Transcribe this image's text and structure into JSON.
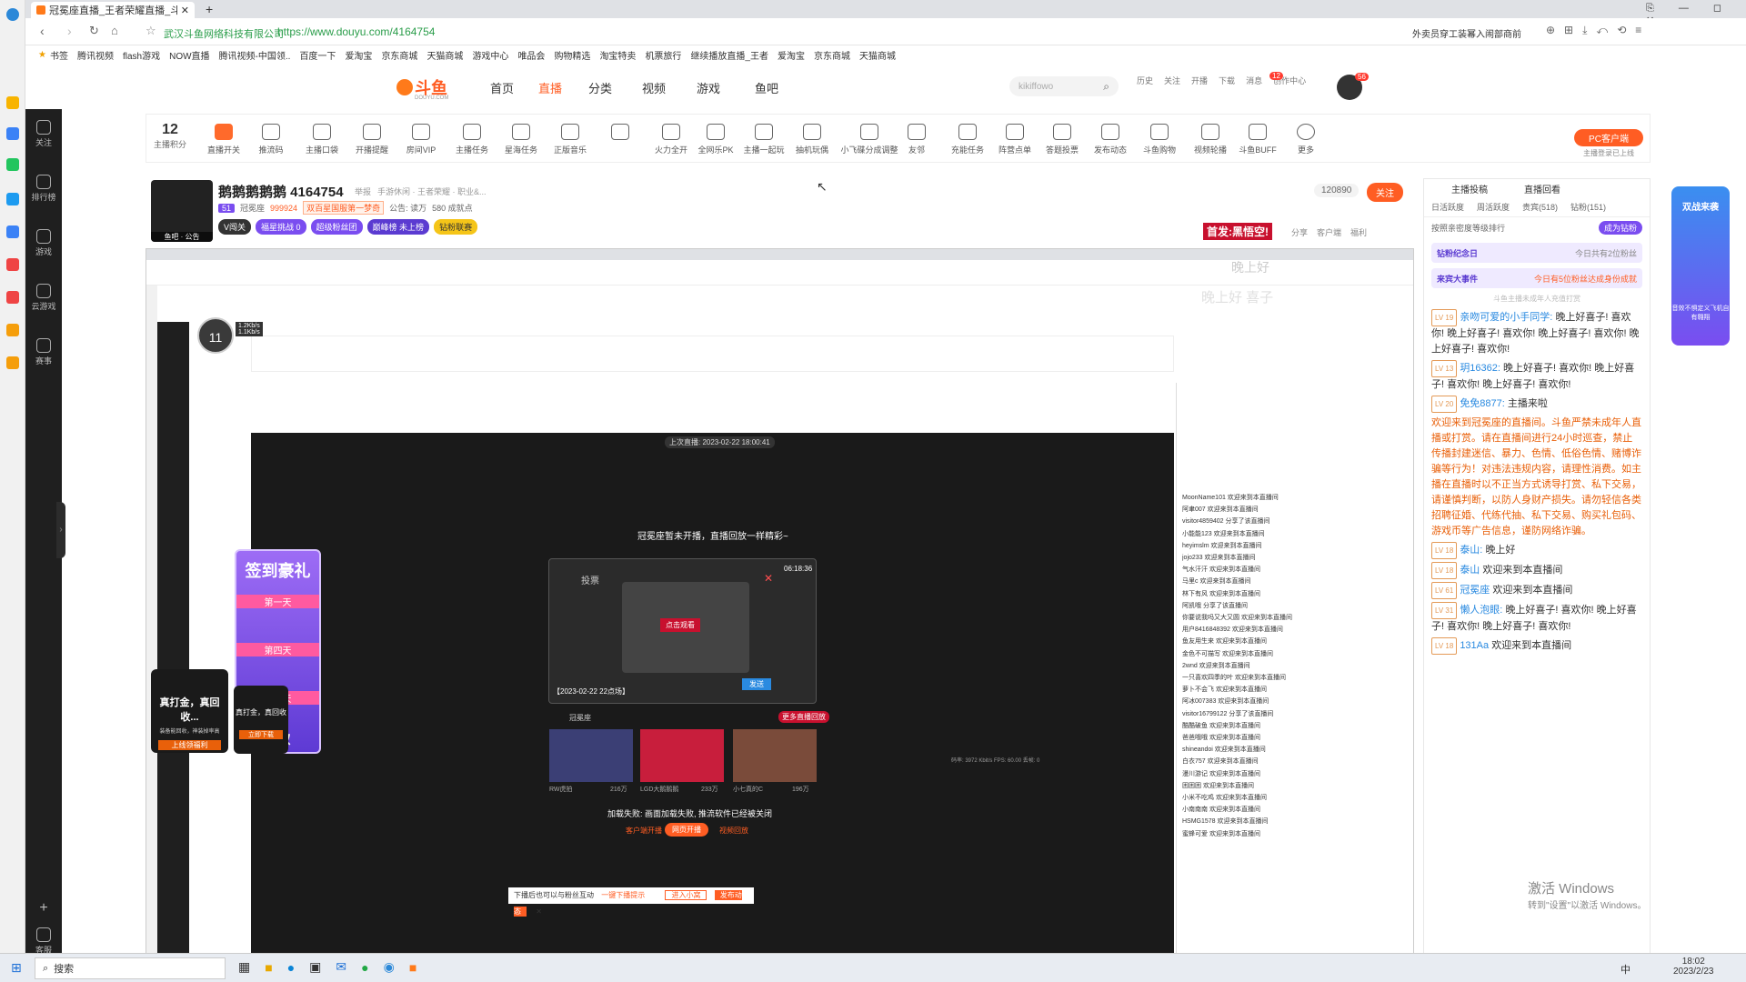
{
  "browser": {
    "tab_title": "冠冕座直播_王者荣耀直播_斗鱼直播",
    "site_name": "武汉斗鱼网络科技有限公司",
    "url": "https://www.douyu.com/4164754",
    "ext_text": "外卖员穿工装幂入闹部商前",
    "bookmarks": [
      "书签",
      "腾讯视频",
      "flash游戏",
      "NOW直播",
      "腾讯视频-中国领..",
      "百度一下",
      "爱淘宝",
      "京东商城",
      "天猫商城",
      "游戏中心",
      "唯品会",
      "购物精选",
      "淘宝特卖",
      "机票旅行",
      "继续播放直播_王者",
      "爱淘宝",
      "京东商城",
      "天猫商城"
    ]
  },
  "site": {
    "logo": "斗鱼",
    "logo_sub": "DOUYU.COM",
    "nav": [
      "首页",
      "直播",
      "分类",
      "视频",
      "游戏",
      "鱼吧"
    ],
    "search_placeholder": "kikiffowo",
    "header_icons": [
      "历史",
      "关注",
      "开播",
      "下载",
      "消息",
      "创作中心"
    ],
    "msg_badge": "12",
    "avatar_badge": "56"
  },
  "toolbar": {
    "points_num": "12",
    "points_label": "主播积分",
    "items": [
      "直播开关",
      "推流码",
      "主播口袋",
      "开播提醒",
      "房间VIP",
      "主播任务",
      "星海任务",
      "正版音乐",
      "",
      "火力全开",
      "全网乐PK",
      "主播一起玩",
      "抽机玩偶",
      "小飞碟分成调整",
      "友邻",
      "充能任务",
      "阵营点单",
      "答题投票",
      "发布动态",
      "斗鱼购物",
      "视频轮播",
      "斗鱼BUFF",
      "更多"
    ],
    "pc_client": "PC客户端",
    "pc_client_sub": "主播登录已上线"
  },
  "room": {
    "name": "鹅鹅鹅鹅鹅 4164754",
    "report": "举报",
    "category": "手游休闲 · 王者荣耀 · 职业&...",
    "level": "51",
    "anchor": "冠冕座",
    "heat": "999924",
    "tag": "双百星国服第一梦奇",
    "notice": "公告: 读万",
    "fans": "580 成就点",
    "badge1": "V闯关",
    "badge2": "福星挑战 0",
    "badge3": "超级粉丝团",
    "badge4": "巅峰榜 未上榜",
    "badge5": "钻粉联赛",
    "follow_count": "120890",
    "follow_btn": "关注",
    "promo": "首发:黑悟空!",
    "share": "分享",
    "client": "客户端",
    "gift_tip": "福利",
    "avatar_caption": "鱼吧 · 公告"
  },
  "capture": {
    "last_live": "上次直播: 2023-02-22 18:00:41",
    "offline_text": "冠冕座暂未开播，直播回放一样精彩~",
    "replay_time": "【2023-02-22 22点场】",
    "duration": "06:18:36",
    "vote_label": "投票",
    "play_btn": "点击观看",
    "send_btn": "发送",
    "anchor_small": "冠冕座",
    "more_replay": "更多直播回放",
    "videos": [
      {
        "title": "RW虎拍",
        "views": "216万"
      },
      {
        "title": "LGD大鹅鹅鹅",
        "views": "233万"
      },
      {
        "title": "小七真的C",
        "views": "196万"
      }
    ],
    "fail_text": "加载失败: 画面加载失败, 推流软件已经被关闭",
    "btn1": "客户端开播",
    "btn2": "网页开播",
    "btn3": "视频回放",
    "bottom_tip": "下播后也可以与粉丝互动",
    "bottom_link": "一键下播提示",
    "bottom_btn1": "进入小窝",
    "bottom_btn2": "发布动态",
    "timer": "11",
    "net_up": "1.2Kb/s",
    "net_down": "1.1Kb/s",
    "signin_title": "签到豪礼",
    "signin_days": [
      "第一天",
      "第四天",
      "第七天"
    ],
    "signin_claim": "领取",
    "game_ad1": "真打金，真回收...",
    "game_ad1_sub": "装备能回收，神装掉率高",
    "game_ad1_btn": "上线领福利",
    "game_ad2": "真打金，真回收",
    "game_ad2_btn": "立即下载",
    "overlay_greeting": "晚上好",
    "overlay_greeting2": "晚上好 喜子",
    "obs_stats": "码率: 3972 Kbit/s FPS: 60.00 丢帧: 0"
  },
  "rightpanel": {
    "tabs_top": [
      "主播投稿",
      "直播回看"
    ],
    "tabs": [
      "日活跃度",
      "周活跃度",
      "贵宾(518)",
      "钻粉(151)"
    ],
    "sort_label": "按照亲密度等级排行",
    "become_fan": "成为钻粉",
    "banner1": "钻粉纪念日",
    "banner1_sub": "今日共有2位粉丝",
    "banner2": "来宾大事件",
    "banner2_sub": "今日有5位粉丝达成身份成就",
    "promo_tag": "双战来袭",
    "promo_sub": "音效不惧定义飞机自有翱翔",
    "float_hint": "斗鱼主播未成年人充值打赏",
    "chat": [
      {
        "lv": "LV 19",
        "name": "亲吻可爱的小手同学:",
        "text": "晚上好喜子! 喜欢你! 晚上好喜子! 喜欢你! 晚上好喜子! 喜欢你! 晚上好喜子! 喜欢你!"
      },
      {
        "lv": "LV 13",
        "name": "玥16362:",
        "text": "晚上好喜子! 喜欢你! 晚上好喜子! 喜欢你! 晚上好喜子! 喜欢你!"
      },
      {
        "lv": "LV 20",
        "name": "免免8877:",
        "text": "主播来啦"
      },
      {
        "lv": "",
        "name": "",
        "text": "欢迎来到冠冕座的直播间。斗鱼严禁未成年人直播或打赏。请在直播间进行24小时巡查，禁止传播封建迷信、暴力、色情、低俗色情、赌博诈骗等行为！对违法违规内容，请理性消费。如主播在直播时以不正当方式诱导打赏、私下交易，请谨慎判断，以防人身财产损失。请勿轻信各类招聘征婚、代练代抽、私下交易、购买礼包码、游戏币等广告信息，谨防网络诈骗。"
      },
      {
        "lv": "LV 18",
        "name": "泰山:",
        "text": "晚上好"
      },
      {
        "lv": "LV 18",
        "name": "泰山",
        "text": "欢迎来到本直播间"
      },
      {
        "lv": "LV 61",
        "name": "冠冕座",
        "text": "欢迎来到本直播间"
      },
      {
        "lv": "LV 31",
        "name": "懒人泡眼:",
        "text": "晚上好喜子! 喜欢你! 晚上好喜子! 喜欢你! 晚上好喜子! 喜欢你!"
      },
      {
        "lv": "LV 18",
        "name": "131Aa",
        "text": "欢迎来到本直播间"
      }
    ],
    "inner_chat": [
      "MoonName101 欢迎来到本直播间",
      "阿聿007 欢迎来到本直播间",
      "visitor4859402 分享了该直播间",
      "小能能123 欢迎来到本直播间",
      "heyimslm 欢迎来到本直播间",
      "jojo233 欢迎来到本直播间",
      "气水汗汗 欢迎来到本直播间",
      "马里c 欢迎来到本直播间",
      "林下有风 欢迎来到本直播间",
      "阿凯哦 分享了该直播间",
      "你要说我吗又大又圆 欢迎来到本直播间",
      "用户8416848392 欢迎来到本直播间",
      "鱼友用生来 欢迎来到本直播间",
      "金色不可描写 欢迎来到本直播间",
      "2wnd 欢迎来到本直播间",
      "一只喜欢四季的叶 欢迎来到本直播间",
      "萝卜不会飞 欢迎来到本直播间",
      "阿冰007383 欢迎来到本直播间",
      "visitor16799122 分享了该直播间",
      "酷酷破鱼 欢迎来到本直播间",
      "爸爸哦哦 欢迎来到本直播间",
      "shineandoi 欢迎来到本直播间",
      "白衣757 欢迎来到本直播间",
      "漫川游记 欢迎来到本直播间",
      "困困困 欢迎来到本直播间",
      "小米不吃鸡 欢迎来到本直播间",
      "小南南南 欢迎来到本直播间",
      "HSMG1578 欢迎来到本直播间",
      "蜜蜂可爱 欢迎来到本直播间"
    ]
  },
  "taskbar": {
    "search": "搜索",
    "time": "18:02",
    "date": "2023/2/23",
    "tray_lang": "中"
  },
  "watermark": {
    "line1": "激活 Windows",
    "line2": "转到\"设置\"以激活 Windows。"
  },
  "colors": {
    "brand_orange": "#ff5d23",
    "accent_purple": "#7a4df0",
    "link_blue": "#2a8ae0",
    "warn_orange": "#e9600a"
  }
}
